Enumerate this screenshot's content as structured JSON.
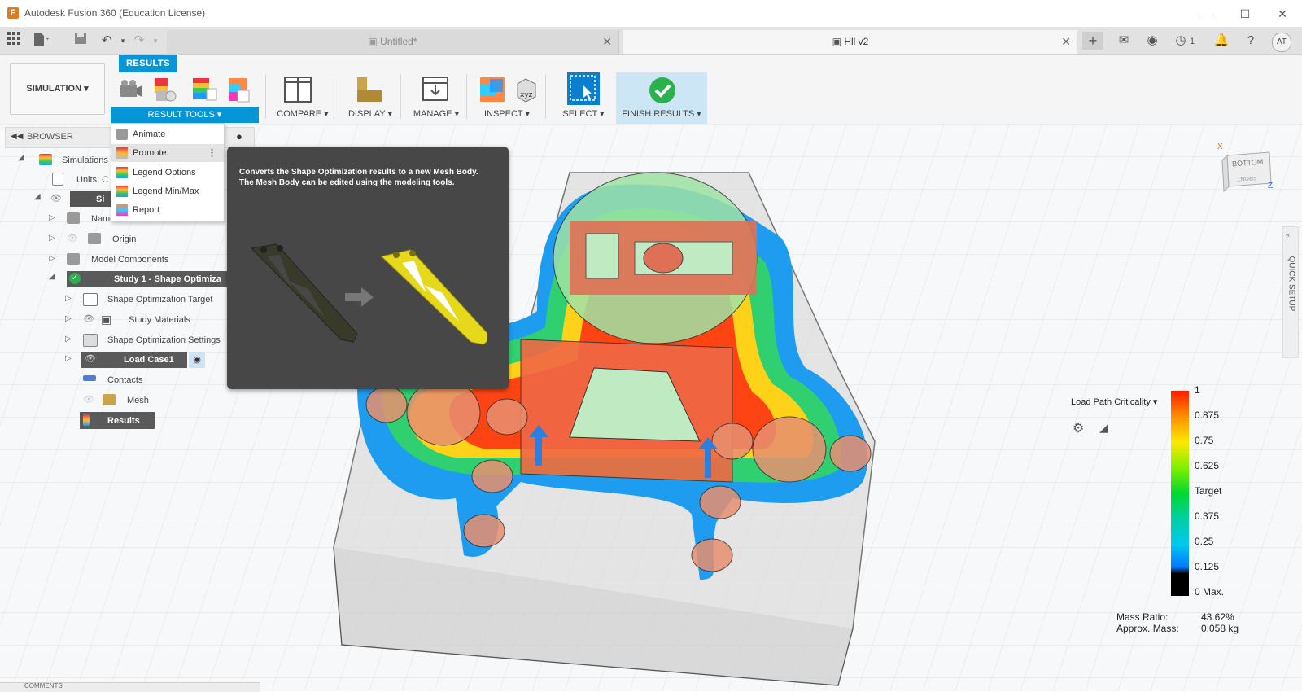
{
  "window": {
    "title": "Autodesk Fusion 360 (Education License)",
    "app_icon": "F"
  },
  "tabs": [
    {
      "label": "Untitled*",
      "active": false
    },
    {
      "label": "Hll v2",
      "active": true
    }
  ],
  "tabbar": {
    "job_count": "1",
    "user_initials": "AT"
  },
  "ribbon": {
    "workspace": "SIMULATION ▾",
    "active_tab": "RESULTS",
    "groups": {
      "result_tools": "RESULT TOOLS ▾",
      "compare": "COMPARE ▾",
      "display": "DISPLAY ▾",
      "manage": "MANAGE ▾",
      "inspect": "INSPECT ▾",
      "select": "SELECT ▾",
      "finish": "FINISH RESULTS ▾"
    }
  },
  "menu": {
    "items": [
      {
        "label": "Animate"
      },
      {
        "label": "Promote"
      },
      {
        "label": "Legend Options"
      },
      {
        "label": "Legend Min/Max"
      },
      {
        "label": "Report"
      }
    ]
  },
  "tooltip": {
    "text": "Converts the Shape Optimization results to a new Mesh Body. The Mesh Body can be edited using the modeling tools."
  },
  "browser": {
    "title": "BROWSER",
    "rows": {
      "simulations": "Simulations",
      "units": "Units: C",
      "sim_model": "Si",
      "named_views": "Named Views",
      "origin": "Origin",
      "model_components": "Model Components",
      "study": "Study 1 - Shape Optimiza",
      "target": "Shape Optimization Target",
      "materials": "Study Materials",
      "settings": "Shape Optimization Settings",
      "load_case": "Load Case1",
      "contacts": "Contacts",
      "mesh": "Mesh",
      "results": "Results"
    }
  },
  "viewcube": {
    "top_face": "BOTTOM",
    "front_face": "FRONT",
    "axis_x": "X",
    "axis_z": "Z"
  },
  "quick_setup": "QUICK SETUP",
  "legend": {
    "title": "Load Path Criticality ▾",
    "ticks": [
      "1",
      "0.875",
      "0.75",
      "0.625",
      "Target",
      "0.375",
      "0.25",
      "0.125",
      "0 Max."
    ],
    "colors": [
      "#ff1a00",
      "#ff8a00",
      "#ffe800",
      "#7cf000",
      "#00d830",
      "#00d0a0",
      "#00c8f0",
      "#0078ff",
      "#000000"
    ]
  },
  "stats": {
    "mass_ratio_label": "Mass Ratio:",
    "mass_ratio_value": "43.62%",
    "approx_mass_label": "Approx. Mass:",
    "approx_mass_value": "0.058 kg"
  },
  "comments": "COMMENTS"
}
